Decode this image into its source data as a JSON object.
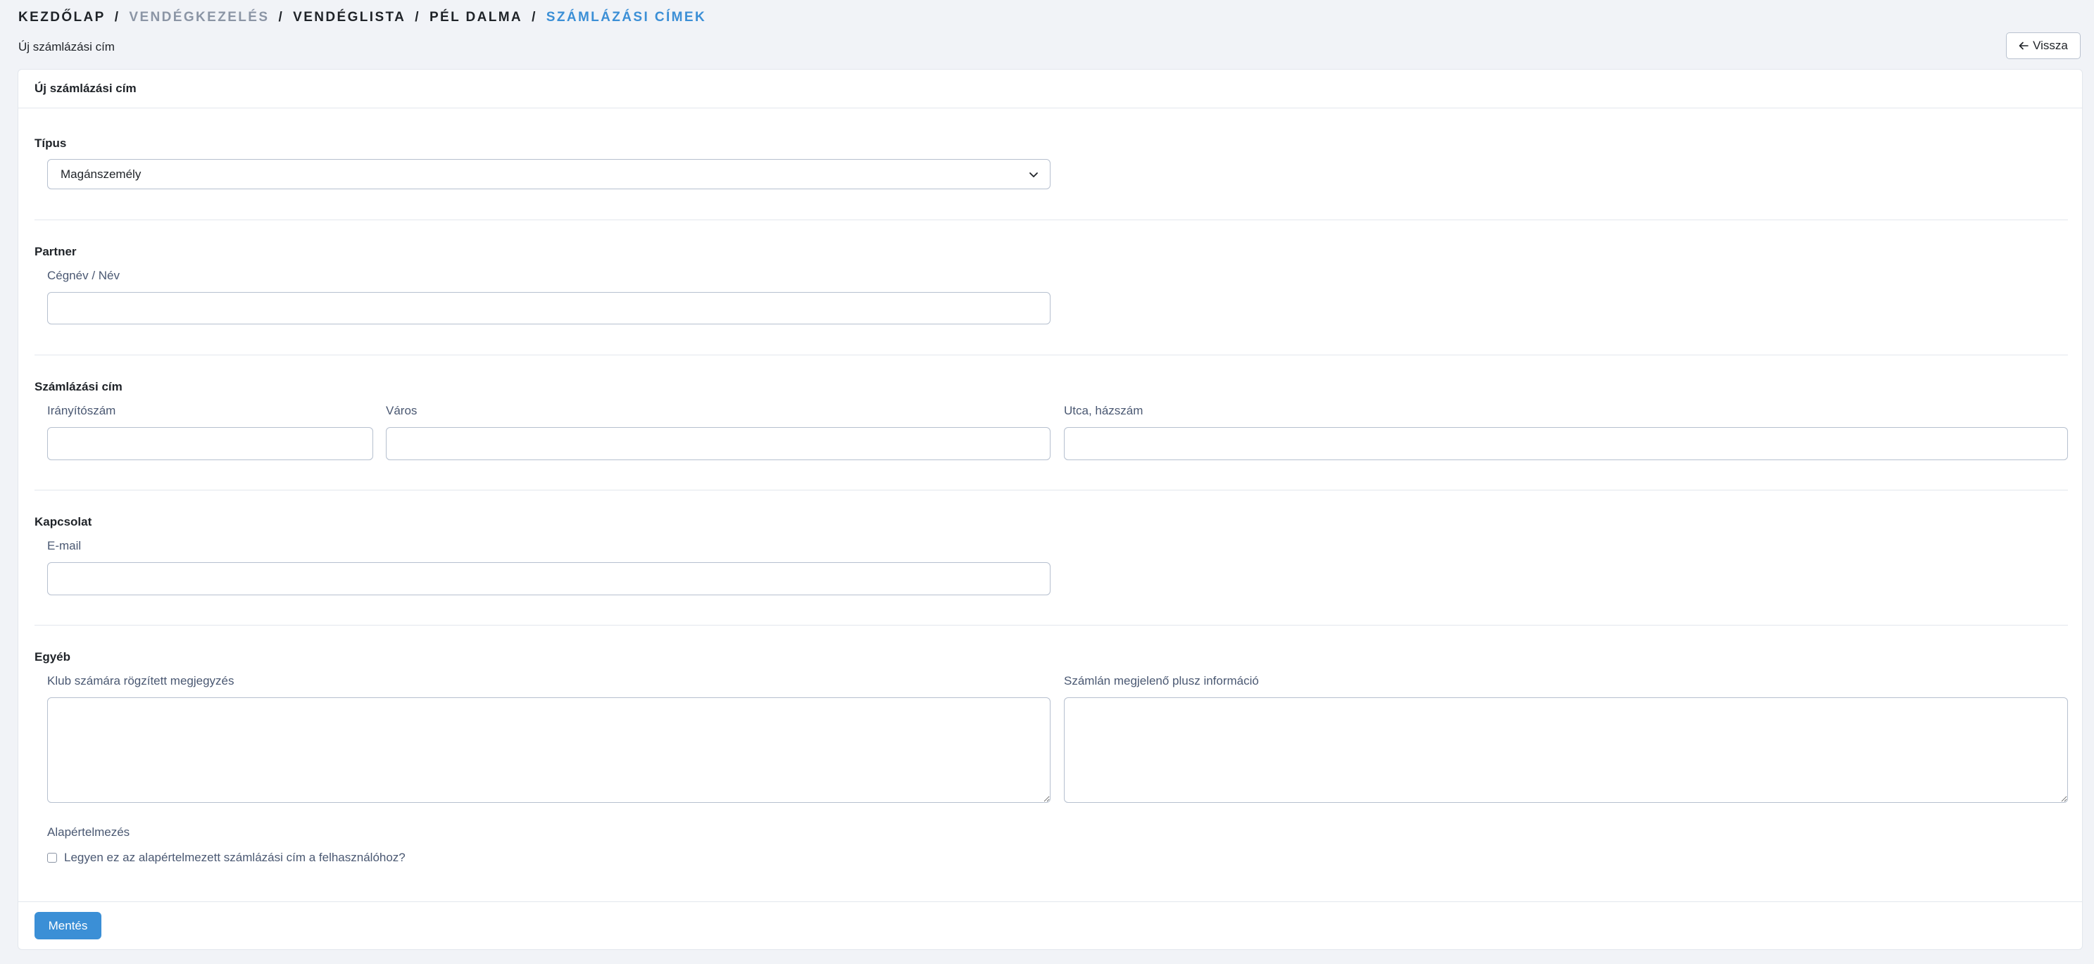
{
  "breadcrumb": {
    "items": [
      "KEZDŐLAP",
      "VENDÉGKEZELÉS",
      "VENDÉGLISTA",
      "PÉL DALMA",
      "SZÁMLÁZÁSI CÍMEK"
    ],
    "separator": "/"
  },
  "page": {
    "subtitle": "Új számlázási cím",
    "back_label": "Vissza",
    "back_icon": "arrow-left-icon"
  },
  "card": {
    "title": "Új számlázási cím",
    "type_section": {
      "title": "Típus",
      "selected": "Magánszemély"
    },
    "partner_section": {
      "title": "Partner",
      "name_label": "Cégnév / Név",
      "name_value": ""
    },
    "address_section": {
      "title": "Számlázási cím",
      "zip_label": "Irányítószám",
      "zip_value": "",
      "city_label": "Város",
      "city_value": "",
      "street_label": "Utca, házszám",
      "street_value": ""
    },
    "contact_section": {
      "title": "Kapcsolat",
      "email_label": "E-mail",
      "email_value": ""
    },
    "other_section": {
      "title": "Egyéb",
      "club_note_label": "Klub számára rögzített megjegyzés",
      "invoice_info_label": "Számlán megjelenő plusz információ",
      "default_label": "Alapértelmezés",
      "default_checkbox_label": "Legyen ez az alapértelmezett számlázási cím a felhasználóhoz?",
      "default_checked": false
    },
    "save_label": "Mentés"
  },
  "colors": {
    "accent": "#3b8fd6",
    "background": "#f1f3f7",
    "muted_breadcrumb": "#8b95a5",
    "label": "#4a5872"
  }
}
